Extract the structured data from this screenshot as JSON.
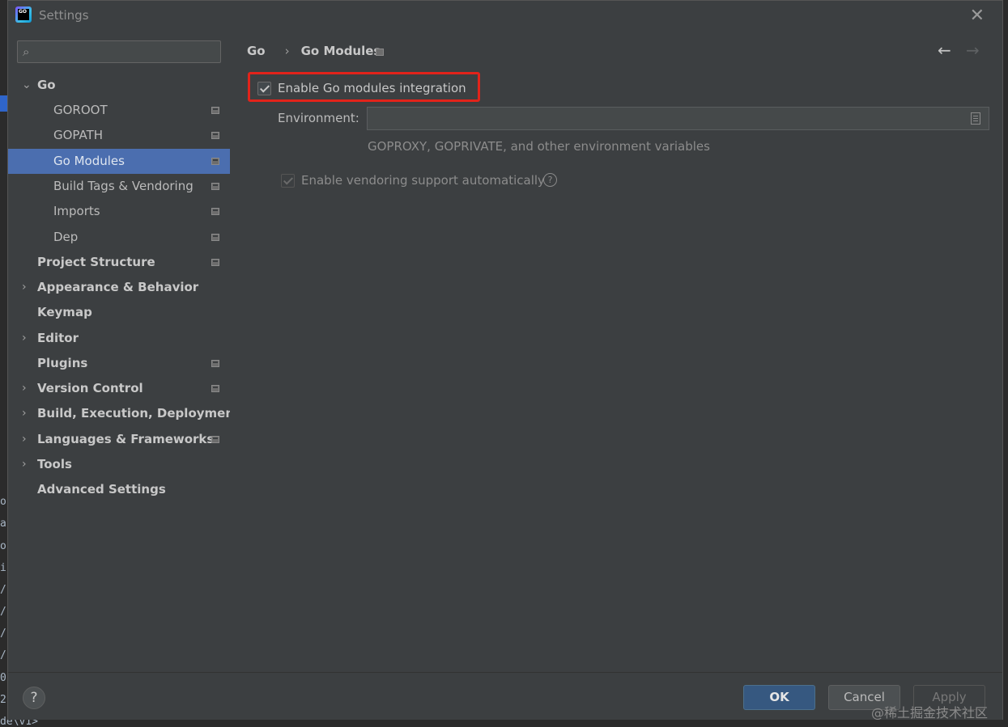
{
  "window": {
    "title": "Settings"
  },
  "search": {
    "value": "",
    "placeholder": ""
  },
  "sidebar": {
    "items": [
      {
        "label": "Go",
        "expander": "expanded"
      },
      {
        "label": "GOROOT"
      },
      {
        "label": "GOPATH"
      },
      {
        "label": "Go Modules",
        "selected": true
      },
      {
        "label": "Build Tags & Vendoring"
      },
      {
        "label": "Imports"
      },
      {
        "label": "Dep"
      },
      {
        "label": "Project Structure"
      },
      {
        "label": "Appearance & Behavior",
        "expander": "collapsed"
      },
      {
        "label": "Keymap"
      },
      {
        "label": "Editor",
        "expander": "collapsed"
      },
      {
        "label": "Plugins"
      },
      {
        "label": "Version Control",
        "expander": "collapsed"
      },
      {
        "label": "Build, Execution, Deployment",
        "expander": "collapsed"
      },
      {
        "label": "Languages & Frameworks",
        "expander": "collapsed"
      },
      {
        "label": "Tools",
        "expander": "collapsed"
      },
      {
        "label": "Advanced Settings"
      }
    ]
  },
  "breadcrumb": {
    "parent": "Go",
    "current": "Go Modules"
  },
  "go_modules": {
    "enable_integration": {
      "label": "Enable Go modules integration",
      "checked": true
    },
    "environment": {
      "label": "Environment:",
      "value": "",
      "hint": "GOPROXY, GOPRIVATE, and other environment variables"
    },
    "enable_vendoring": {
      "label": "Enable vendoring support automatically",
      "checked": true,
      "disabled": true
    }
  },
  "footer": {
    "ok": "OK",
    "cancel": "Cancel",
    "apply": "Apply",
    "help": "?"
  },
  "background_editor": {
    "lines": [
      "o",
      "a",
      "o",
      "i",
      "/",
      "/",
      "/",
      "/",
      "0",
      "2"
    ],
    "bottom": "de\\v1>"
  },
  "watermark": "@稀土掘金技术社区",
  "colors": {
    "selection": "#4b6eaf",
    "highlight_box": "#e2231a",
    "ok_button": "#365880"
  }
}
